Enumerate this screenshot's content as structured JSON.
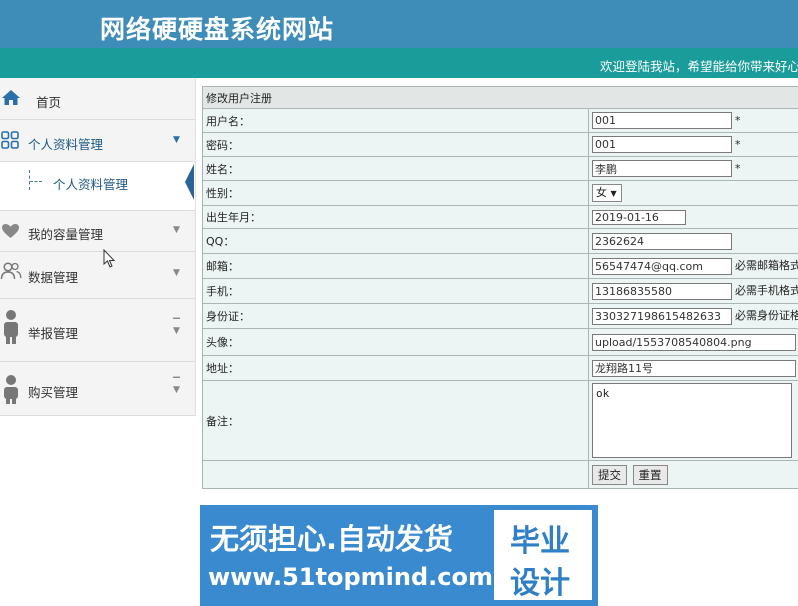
{
  "header": {
    "site_title": "网络硬硬盘系统网站",
    "welcome_text": "欢迎登陆我站，希望能给你带来好心"
  },
  "sidebar": {
    "items": [
      {
        "label": "首页",
        "icon": "home-icon"
      },
      {
        "label": "个人资料管理",
        "icon": "grid-icon"
      },
      {
        "label": "我的容量管理",
        "icon": "heart-icon"
      },
      {
        "label": "数据管理",
        "icon": "users-icon"
      },
      {
        "label": "举报管理",
        "icon": "person-icon"
      },
      {
        "label": "购买管理",
        "icon": "person-icon"
      }
    ],
    "sub_item": "个人资料管理"
  },
  "form": {
    "title": "修改用户注册",
    "required_mark": "*",
    "username_label": "用户名：",
    "username_value": "001",
    "password_label": "密码：",
    "password_value": "001",
    "name_label": "姓名：",
    "name_value": "李鹏",
    "gender_label": "性别：",
    "gender_value": "女",
    "birth_label": "出生年月：",
    "birth_value": "2019-01-16",
    "qq_label": "QQ：",
    "qq_value": "2362624",
    "email_label": "邮箱：",
    "email_value": "56547474@qq.com",
    "email_note": "必需邮箱格式",
    "phone_label": "手机：",
    "phone_value": "13186835580",
    "phone_note": "必需手机格式",
    "idcard_label": "身份证：",
    "idcard_value": "330327198615482633",
    "idcard_note": "必需身份证格",
    "avatar_label": "头像：",
    "avatar_value": "upload/1553708540804.png",
    "address_label": "地址：",
    "address_value": "龙翔路11号",
    "remark_label": "备注：",
    "remark_value": "ok",
    "submit_label": "提交",
    "reset_label": "重置"
  },
  "banner": {
    "line1": "无须担心.自动发货",
    "line2": "www.51topmind.com",
    "box_line1": "毕业",
    "box_line2": "设计"
  },
  "colors": {
    "header_blue": "#3e8cb8",
    "teal_bar": "#1a9c9a",
    "form_bg": "#ecf5f3",
    "banner_blue": "#3a8ad0"
  }
}
